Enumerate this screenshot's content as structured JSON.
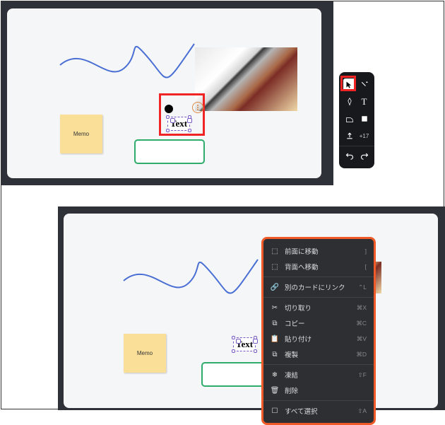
{
  "canvas": {
    "sticky_label": "Memo",
    "text_node": "Text"
  },
  "toolbar": {
    "cursor": "↖",
    "magic": "✦",
    "pen": "✎",
    "text_tool": "T",
    "shape": "▢",
    "square": "■",
    "upload": "↥",
    "plus_count": "+17",
    "undo": "↶",
    "redo": "↷"
  },
  "context_menu": [
    {
      "icon": "⬚",
      "label": "前面に移動",
      "shortcut": "]"
    },
    {
      "icon": "⬚",
      "label": "背面へ移動",
      "shortcut": "["
    },
    {
      "sep": true
    },
    {
      "icon": "🔗",
      "label": "別のカードにリンク",
      "shortcut": "⌃L"
    },
    {
      "sep": true
    },
    {
      "icon": "✂",
      "label": "切り取り",
      "shortcut": "⌘X"
    },
    {
      "icon": "⧉",
      "label": "コピー",
      "shortcut": "⌘C"
    },
    {
      "icon": "📋",
      "label": "貼り付け",
      "shortcut": "⌘V"
    },
    {
      "icon": "⧉",
      "label": "複製",
      "shortcut": "⌘D"
    },
    {
      "sep": true
    },
    {
      "icon": "❄",
      "label": "凍結",
      "shortcut": "⇧F"
    },
    {
      "icon": "🗑",
      "label": "削除",
      "shortcut": ""
    },
    {
      "sep": true
    },
    {
      "icon": "☐",
      "label": "すべて選択",
      "shortcut": "⇧A"
    }
  ]
}
